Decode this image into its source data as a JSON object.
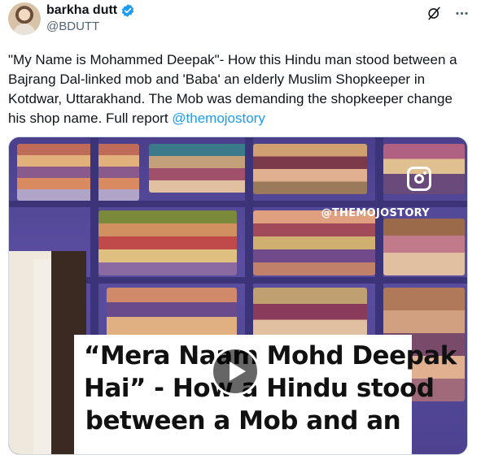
{
  "author": {
    "display_name": "barkha dutt",
    "handle": "@BDUTT"
  },
  "tweet": {
    "text_main": "\"My Name is Mohammed Deepak\"- How this Hindu man stood between a Bajrang Dal-linked mob and 'Baba' an elderly Muslim Shopkeeper in Kotdwar, Uttarakhand. The Mob was demanding the shopkeeper change his shop name. Full report ",
    "mention": "@themojostory"
  },
  "media": {
    "watermark": "@THEMOJOSTORY",
    "caption_lines": [
      "“Mera Naam Mohd Deepak",
      "Hai” - How a Hindu stood",
      "between a Mob and an"
    ]
  },
  "icons": {
    "verified": "verified-badge-icon",
    "grok": "grok-icon",
    "more": "more-icon",
    "instagram": "instagram-icon",
    "play": "play-icon"
  },
  "colors": {
    "accent": "#1d9bf0",
    "text": "#0f1419",
    "secondary": "#536471"
  }
}
